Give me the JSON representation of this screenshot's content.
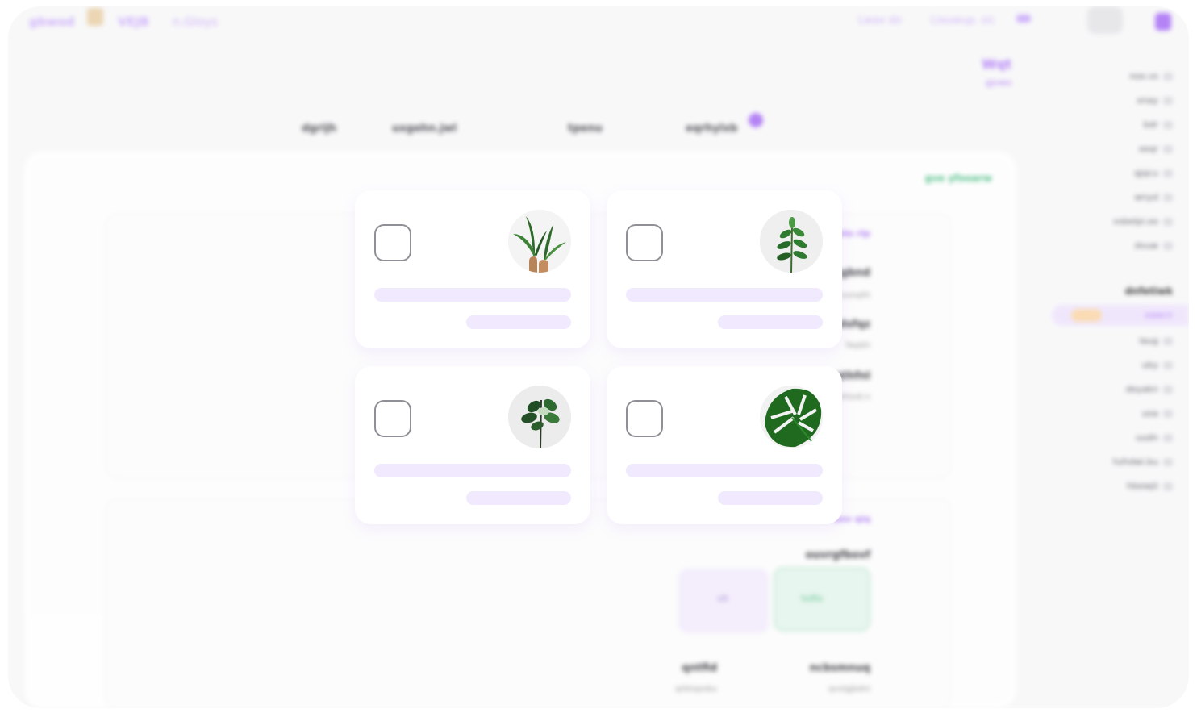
{
  "topbar": {
    "brand_left": "gbwod",
    "link_a": "VEJB",
    "link_b": "n.Gloys",
    "link_right_a": "Lwax do",
    "link_right_b": "Liouwup. sic"
  },
  "sidebar": {
    "items": [
      "nox.vs",
      "xnay",
      "bdr",
      "xeqr",
      "qjqcu",
      "wnyd",
      "vsbelpi.oo",
      "dvuw"
    ],
    "section_head": "dnfetiwk",
    "active_item": "xawcn",
    "items2": [
      "laug",
      "uby",
      "deyakn",
      "uoa",
      "uudn",
      "hzhdwi.bu",
      "hbewjii"
    ]
  },
  "header": {
    "title": "Wqt",
    "subtitle": "gjvwo"
  },
  "tabs": [
    "dgrijh",
    "uxgehn.jwl",
    "tpenu",
    "eqrhylxb"
  ],
  "main": {
    "green_link": "gve yfooarw",
    "card1": {
      "link": "uto rlp",
      "rows": [
        {
          "label": "ngbnd",
          "sub": "eunqlih"
        },
        {
          "label": "idsfqz",
          "sub": "fwpbh"
        },
        {
          "label": "ugthfnl",
          "sub": "uzcbhtxdi.n"
        }
      ]
    },
    "card2": {
      "link": "uov qiq",
      "label": "ouvrgfbovf",
      "box_purple": "ub",
      "box_green": "ludlu",
      "bottom_left_label": "qntfid",
      "bottom_left_sub": "qrbtepobu",
      "bottom_right_label": "ncbsmnuq",
      "bottom_right_sub": "qvxlgjbdni"
    }
  },
  "plant_cards": [
    {
      "icon": "potted-banana-plant-image"
    },
    {
      "icon": "rubber-tree-sapling-image"
    },
    {
      "icon": "fiddle-leaf-fig-image"
    },
    {
      "icon": "monstera-leaf-image"
    }
  ],
  "colors": {
    "accent": "#a86ff5",
    "accent_light": "#f1e9fd",
    "success": "#3cb878",
    "checkbox_border": "#8f8f96"
  }
}
